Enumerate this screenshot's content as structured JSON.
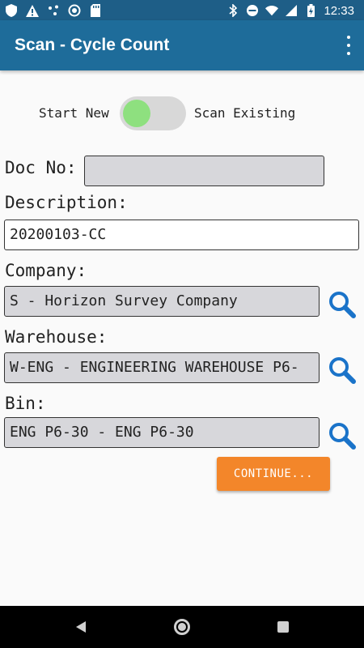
{
  "status_bar": {
    "time": "12:33",
    "left_icons": [
      "shield-icon",
      "warning-icon",
      "share-network-icon",
      "data-saver-icon",
      "sd-card-icon"
    ],
    "right_icons": [
      "bluetooth-icon",
      "do-not-disturb-icon",
      "wifi-icon",
      "cellular-icon",
      "battery-charging-icon"
    ]
  },
  "app_bar": {
    "title": "Scan - Cycle Count",
    "overflow_icon": "more-vert-icon"
  },
  "toggle": {
    "left_label": "Start New",
    "right_label": "Scan Existing",
    "state": "off"
  },
  "form": {
    "doc_no": {
      "label": "Doc No:",
      "value": ""
    },
    "description": {
      "label": "Description:",
      "value": "20200103-CC"
    },
    "company": {
      "label": "Company:",
      "value": "S - Horizon Survey Company"
    },
    "warehouse": {
      "label": "Warehouse:",
      "value": "W-ENG - ENGINEERING WAREHOUSE P6-"
    },
    "bin": {
      "label": "Bin:",
      "value": "ENG P6-30 - ENG P6-30"
    }
  },
  "continue_button": {
    "label": "CONTINUE..."
  },
  "colors": {
    "status_bar": "#1e5e87",
    "app_bar": "#1e6c9a",
    "accent_orange": "#f3862a",
    "toggle_thumb": "#8ee07f",
    "search_icon": "#1a73c9"
  },
  "nav_bar": {
    "icons": [
      "back-icon",
      "home-icon",
      "recents-icon"
    ]
  }
}
